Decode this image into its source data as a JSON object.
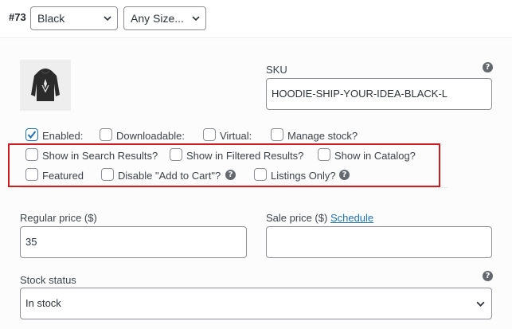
{
  "header": {
    "variation_id": "#73",
    "color_select": "Black",
    "size_select": "Any Size..."
  },
  "sku": {
    "label": "SKU",
    "value": "HOODIE-SHIP-YOUR-IDEA-BLACK-L"
  },
  "options_row1": [
    {
      "label": "Enabled:",
      "checked": true
    },
    {
      "label": "Downloadable:",
      "checked": false
    },
    {
      "label": "Virtual:",
      "checked": false
    },
    {
      "label": "Manage stock?",
      "checked": false
    }
  ],
  "options_row2": [
    {
      "label": "Show in Search Results?",
      "checked": false
    },
    {
      "label": "Show in Filtered Results?",
      "checked": false
    },
    {
      "label": "Show in Catalog?",
      "checked": false
    }
  ],
  "options_row3": [
    {
      "label": "Featured",
      "checked": false
    },
    {
      "label": "Disable \"Add to Cart\"?",
      "checked": false
    },
    {
      "label": "Listings Only?",
      "checked": false
    }
  ],
  "pricing": {
    "regular_label": "Regular price ($)",
    "regular_value": "35",
    "sale_label": "Sale price ($)",
    "sale_link": "Schedule",
    "sale_value": ""
  },
  "stock": {
    "label": "Stock status",
    "value": "In stock"
  },
  "icons": {
    "help": "?"
  },
  "colors": {
    "accent": "#2271b1",
    "highlight": "#cc1d24"
  }
}
